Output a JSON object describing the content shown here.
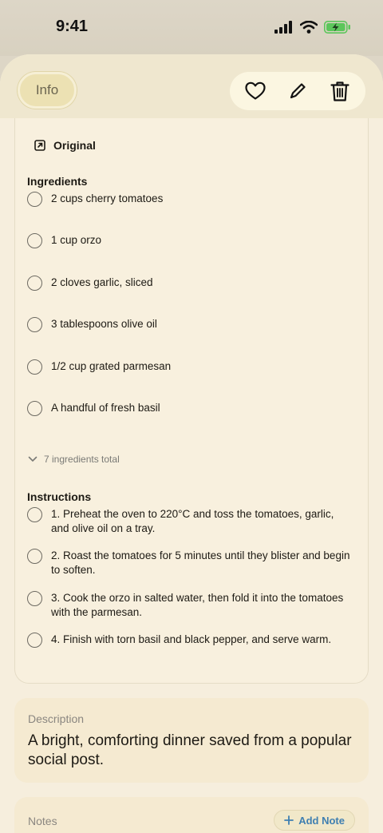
{
  "status_bar": {
    "time": "9:41"
  },
  "header": {
    "info_label": "Info",
    "favorite_icon": "heart-icon",
    "edit_icon": "pencil-icon",
    "delete_icon": "trash-icon"
  },
  "recipe": {
    "original_label": "Original",
    "ingredients_title": "Ingredients",
    "ingredients": [
      "2 cups cherry tomatoes",
      "1 cup orzo",
      "2 cloves garlic, sliced",
      "3 tablespoons olive oil",
      "1/2 cup grated parmesan",
      "A handful of fresh basil"
    ],
    "ingredients_total": "7 ingredients total",
    "instructions_title": "Instructions",
    "instructions": [
      "1. Preheat the oven to 220°C and toss the tomatoes, garlic, and olive oil on a tray.",
      "2. Roast the tomatoes for 5 minutes until they blister and begin to soften.",
      "3. Cook the orzo in salted water, then fold it into the tomatoes with the parmesan.",
      "4. Finish with torn basil and black pepper, and serve warm."
    ]
  },
  "description": {
    "label": "Description",
    "text": "A bright, comforting dinner saved from a popular social post."
  },
  "notes": {
    "label": "Notes",
    "add_label": "Add Note"
  },
  "colors": {
    "sheet_background": "#f6eedd",
    "accent_blue": "#3f7fb1",
    "battery_green": "#5cc65b"
  }
}
